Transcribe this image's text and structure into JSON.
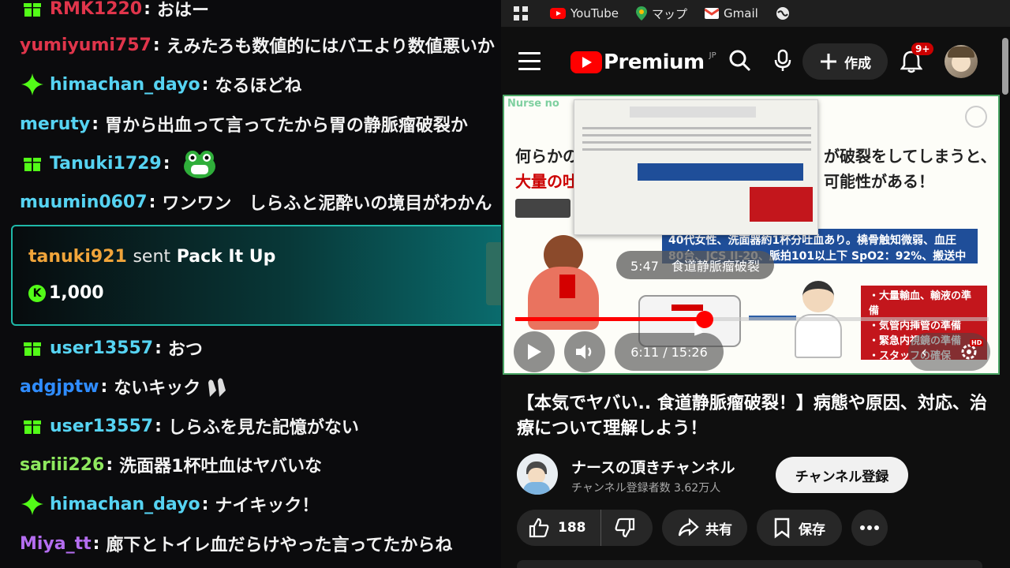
{
  "chat": {
    "messages": [
      {
        "badge": "gift",
        "user": "RMK1220",
        "color": "#e0354b",
        "text": "おはー"
      },
      {
        "badge": "",
        "user": "yumiyumi757",
        "color": "#e0354b",
        "text": "えみたろも数値的にはバエより数値悪いか"
      },
      {
        "badge": "sparkle",
        "user": "himachan_dayo",
        "color": "#56d3f2",
        "text": "なるほどね"
      },
      {
        "badge": "",
        "user": "meruty",
        "color": "#56d3f2",
        "text": "胃から出血って言ってたから胃の静脈瘤破裂か"
      },
      {
        "badge": "gift",
        "user": "Tanuki1729",
        "color": "#56d3f2",
        "text": ""
      },
      {
        "badge": "",
        "user": "muumin0607",
        "color": "#56d3f2",
        "text": "ワンワン　しらふと泥酔いの境目がわかん"
      },
      {
        "badge": "gift",
        "user": "user13557",
        "color": "#56d3f2",
        "text": "おつ"
      },
      {
        "badge": "",
        "user": "adgjptw",
        "color": "#2f8cff",
        "text": "ないキック"
      },
      {
        "badge": "gift",
        "user": "user13557",
        "color": "#56d3f2",
        "text": "しらふを見た記憶がない"
      },
      {
        "badge": "",
        "user": "sariii226",
        "color": "#8ee85e",
        "text": "洗面器1杯吐血はヤバいな"
      },
      {
        "badge": "sparkle",
        "user": "himachan_dayo",
        "color": "#56d3f2",
        "text": "ナイキック！"
      },
      {
        "badge": "",
        "user": "Miya_tt",
        "color": "#b46df0",
        "text": "廊下とトイレ血だらけやった言ってたからね"
      }
    ],
    "gift": {
      "user": "tanuki921",
      "sent": "sent",
      "item": "Pack It Up",
      "coin_icon": "K",
      "amount": "1,000"
    }
  },
  "youtube": {
    "bookmarks": [
      {
        "label": "",
        "icon": "apps-grid-icon"
      },
      {
        "label": "YouTube",
        "icon": "youtube-icon"
      },
      {
        "label": "マップ",
        "icon": "maps-icon"
      },
      {
        "label": "Gmail",
        "icon": "gmail-icon"
      },
      {
        "label": "",
        "icon": "globe-icon"
      }
    ],
    "logo_text": "Premium",
    "logo_region": "JP",
    "create_label": "作成",
    "notification_count": "9+",
    "player": {
      "brand": "Nurse no",
      "heading_left_1": "何らかの",
      "heading_left_2": "大量の吐",
      "heading_right_1": "が破裂をしてしまうと、",
      "heading_right_2": "可能性がある！",
      "info_text": "40代女性、洗面器約1杯分吐血あり。橈骨触知微弱、血圧80台、JCS II-20、脈拍101以上下 SpO2：92%、搬送中も吐血あり",
      "treatment_items": [
        "・大量輸血、輸液の準備",
        "・気管内挿管の準備",
        "・緊急内視鏡の準備",
        "・スタッフの確保"
      ],
      "chapter_preview": "5:47　食道静脈瘤破裂",
      "current_time": "6:11",
      "duration": "15:26",
      "time_display": "6:11 / 15:26",
      "progress": 0.4
    },
    "video_title": "【本気でヤバい.. 食道静脈瘤破裂！】病態や原因、対応、治療について理解しよう！",
    "channel_name": "ナースの頂きチャンネル",
    "subscriber_count": "チャンネル登録者数 3.62万人",
    "subscribe_label": "チャンネル登録",
    "like_count": "188",
    "share_label": "共有",
    "save_label": "保存",
    "colors": {
      "accent": "#ff0000",
      "kick": "#53fc18",
      "panel": "#272727"
    }
  }
}
